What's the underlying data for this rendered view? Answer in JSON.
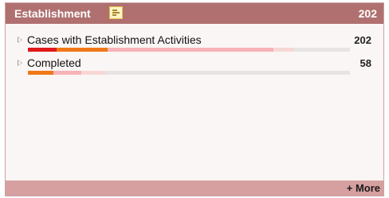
{
  "panel": {
    "title": "Establishment",
    "total": "202",
    "chart_toggle_icon": "bar-chart-icon",
    "colors": {
      "header": "#b07070",
      "footer": "#d6a0a0",
      "body": "#faf6f5",
      "segment_red": "#e01a1a",
      "segment_orange": "#f07818",
      "segment_pink": "#f6b3b8",
      "segment_light_pink": "#f7d7d4",
      "bar_track": "#e6e4e4"
    }
  },
  "rows": [
    {
      "label": "Cases with Establishment Activities",
      "count": "202",
      "expand_icon": "triangle-right-icon",
      "segments": [
        {
          "color": "#e01a1a",
          "fraction": 0.089
        },
        {
          "color": "#f07818",
          "fraction": 0.158
        },
        {
          "color": "#f6b3b8",
          "fraction": 0.515
        },
        {
          "color": "#f7d7d4",
          "fraction": 0.064
        }
      ]
    },
    {
      "label": "Completed",
      "count": "58",
      "expand_icon": "triangle-right-icon",
      "segments": [
        {
          "color": "#f07818",
          "fraction": 0.079
        },
        {
          "color": "#f6b3b8",
          "fraction": 0.087
        },
        {
          "color": "#f7d7d4",
          "fraction": 0.074
        }
      ]
    }
  ],
  "footer": {
    "more_label": "+ More"
  }
}
